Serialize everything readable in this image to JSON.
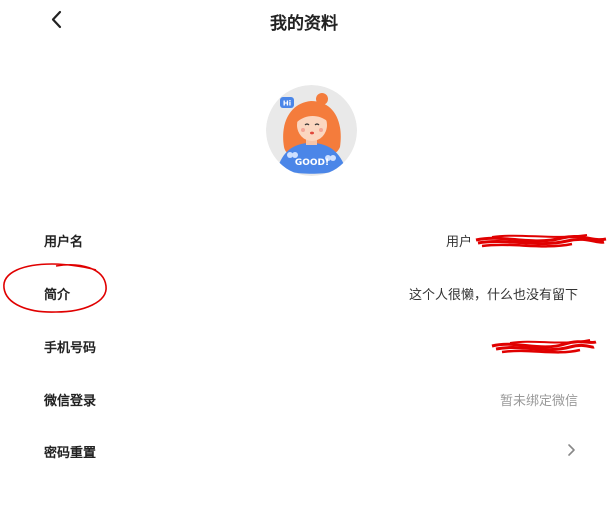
{
  "header": {
    "title": "我的资料",
    "back_icon": "chevron-left-icon"
  },
  "avatar": {
    "badge_text": "Hi",
    "shirt_text": "GOOD!",
    "colors": {
      "background": "#e9e9e9",
      "hair": "#f47c3c",
      "shirt": "#4b86e8"
    }
  },
  "profile": {
    "rows": [
      {
        "label": "用户名",
        "value": "用户"
      },
      {
        "label": "简介",
        "value": "这个人很懒，什么也没有留下"
      },
      {
        "label": "手机号码",
        "value": ""
      },
      {
        "label": "微信登录",
        "value": "暂未绑定微信"
      },
      {
        "label": "密码重置",
        "value": "",
        "icon": "chevron-right-icon"
      }
    ]
  },
  "annotation": {
    "color": "#e00000"
  }
}
